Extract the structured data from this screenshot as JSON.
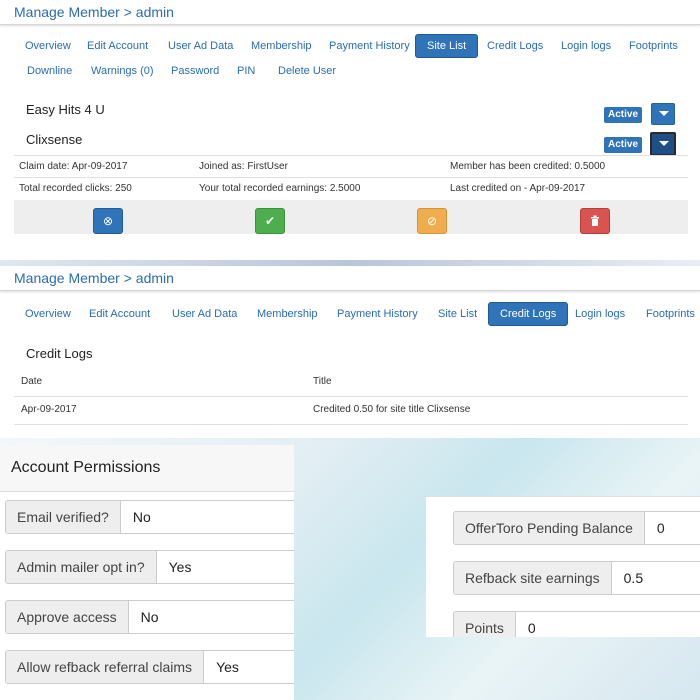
{
  "panel1": {
    "heading": "Manage Member > admin",
    "tabs": [
      "Overview",
      "Edit Account",
      "User Ad Data",
      "Membership",
      "Payment History",
      "Site List",
      "Credit Logs",
      "Login logs",
      "Footprints"
    ],
    "tabs_row2": [
      "Downline",
      "Warnings (0)",
      "Password",
      "PIN",
      "Delete User"
    ],
    "active_tab": "Site List",
    "sites": [
      {
        "name": "Easy Hits 4 U",
        "status": "Active"
      },
      {
        "name": "Clixsense",
        "status": "Active"
      }
    ],
    "claim_date": "Claim date: Apr-09-2017",
    "joined_as": "Joined as: FirstUser",
    "credited": "Member has been credited: 0.5000",
    "total_clicks": "Total recorded clicks: 250",
    "total_earnings": "Your total recorded earnings: 2.5000",
    "last_credited": "Last credited on - Apr-09-2017",
    "action_icons": [
      "cancel-icon",
      "check-icon",
      "ban-icon",
      "trash-icon"
    ],
    "colors": {
      "primary": "#2f73b9",
      "success": "#4cae4c",
      "warning": "#f0ad4e",
      "danger": "#d9534f"
    }
  },
  "panel2": {
    "heading": "Manage Member > admin",
    "tabs": [
      "Overview",
      "Edit Account",
      "User Ad Data",
      "Membership",
      "Payment History",
      "Site List",
      "Credit Logs",
      "Login logs",
      "Footprints"
    ],
    "active_tab": "Credit Logs",
    "title": "Credit Logs",
    "columns": [
      "Date",
      "Title"
    ],
    "rows": [
      [
        "Apr-09-2017",
        "Credited 0.50 for site title Clixsense"
      ]
    ]
  },
  "permissions": {
    "title": "Account Permissions",
    "items": [
      {
        "label": "Email verified?",
        "value": "No"
      },
      {
        "label": "Admin mailer opt in?",
        "value": "Yes"
      },
      {
        "label": "Approve access",
        "value": "No"
      },
      {
        "label": "Allow refback referral claims",
        "value": "Yes"
      }
    ]
  },
  "balances": {
    "items": [
      {
        "label": "OfferToro Pending Balance",
        "value": "0"
      },
      {
        "label": "Refback site earnings",
        "value": "0.5"
      },
      {
        "label": "Points",
        "value": "0"
      }
    ]
  }
}
